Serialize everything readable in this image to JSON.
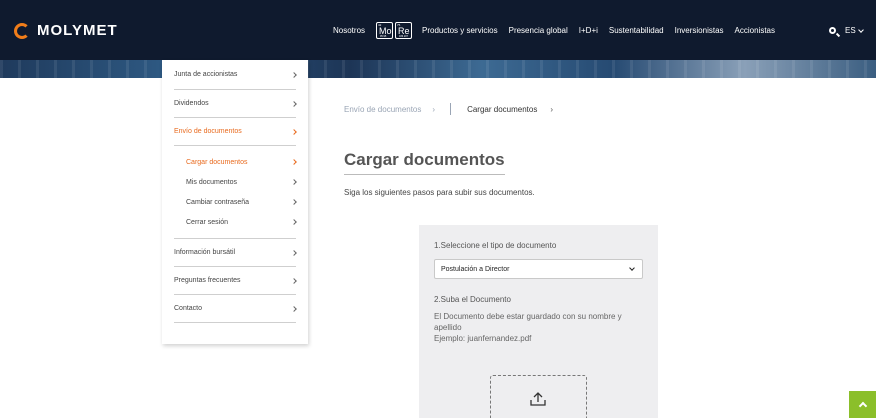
{
  "header": {
    "logo_text": "MOLYMET",
    "logo_accent": "#f07d1a",
    "bg_color": "#0f1a2e",
    "nav": {
      "nosotros": "Nosotros",
      "productos": "Productos y servicios",
      "presencia": "Presencia global",
      "idi": "I+D+i",
      "sustentabilidad": "Sustentabilidad",
      "inversionistas": "Inversionistas",
      "accionistas": "Accionistas"
    },
    "elements": [
      {
        "number": "42",
        "symbol": "Mo",
        "mass": "95.95"
      },
      {
        "number": "75",
        "symbol": "Re",
        "mass": "186.207"
      }
    ],
    "search_icon": "search-icon",
    "language": "ES"
  },
  "sidebar": {
    "items": [
      {
        "label": "Junta de accionistas"
      },
      {
        "label": "Dividendos"
      },
      {
        "label": "Envío de documentos"
      }
    ],
    "sub_items": [
      {
        "label": "Cargar documentos"
      },
      {
        "label": "Mis documentos"
      },
      {
        "label": "Cambiar contraseña"
      },
      {
        "label": "Cerrar sesión"
      }
    ],
    "items_after": [
      {
        "label": "Información bursátil"
      },
      {
        "label": "Preguntas frecuentes"
      },
      {
        "label": "Contacto"
      }
    ],
    "active_color": "#e86a1e"
  },
  "breadcrumb": {
    "parent": "Envío de documentos",
    "current": "Cargar documentos"
  },
  "main": {
    "title": "Cargar documentos",
    "subtitle": "Siga los siguientes pasos para subir sus documentos."
  },
  "form": {
    "step1_label": "1.Seleccione el tipo de documento",
    "document_type_selected": "Postulación a Director",
    "step2_label": "2.Suba el Documento",
    "instructions_line1": "El Documento debe estar guardado con su nombre y apellido",
    "instructions_line2": "Ejemplo: juanfernandez.pdf",
    "upload_icon": "upload-icon"
  },
  "scroll_top": {
    "color": "#8bbf2a",
    "icon": "chevron-up-icon"
  }
}
